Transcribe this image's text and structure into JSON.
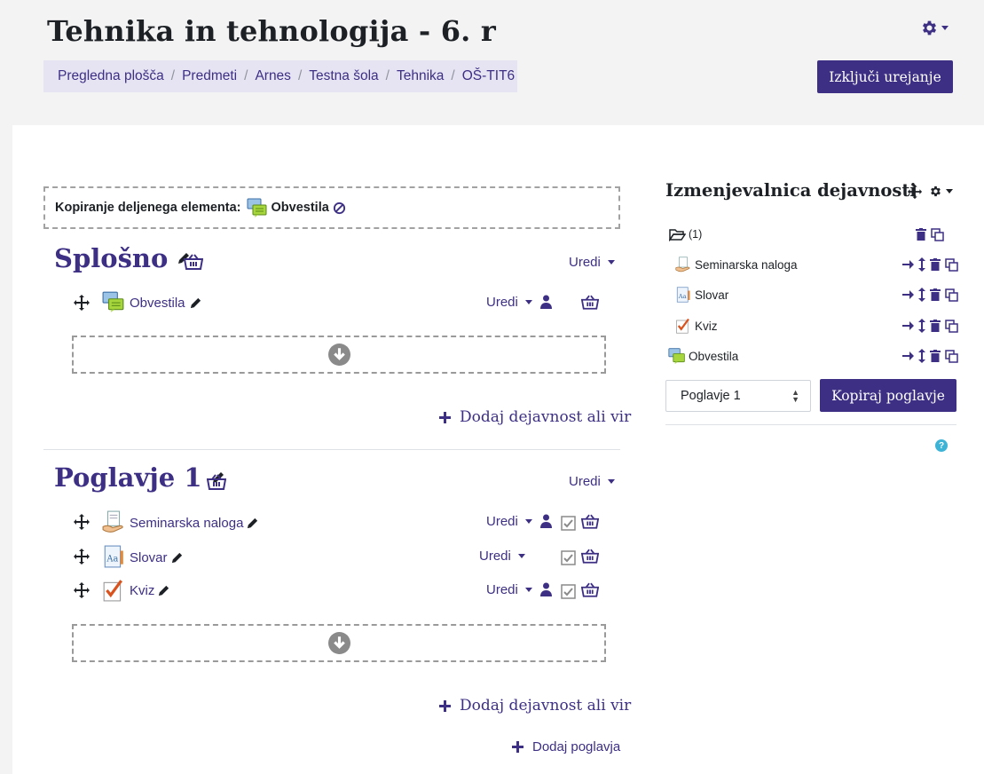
{
  "page": {
    "title": "Tehnika in tehnologija - 6. r",
    "edit_toggle_label": "Izključi urejanje"
  },
  "breadcrumb": [
    "Pregledna plošča",
    "Predmeti",
    "Arnes",
    "Testna šola",
    "Tehnika",
    "OŠ-TIT6"
  ],
  "copy_notice": {
    "label": "Kopiranje deljenega elementa:",
    "item": "Obvestila"
  },
  "sections": [
    {
      "title": "Splošno",
      "edit_label": "Uredi",
      "activities": [
        {
          "name": "Obvestila",
          "icon": "forum-icon",
          "edit_label": "Uredi"
        }
      ],
      "add_label": "Dodaj dejavnost ali vir"
    },
    {
      "title": "Poglavje 1",
      "edit_label": "Uredi",
      "activities": [
        {
          "name": "Seminarska naloga",
          "icon": "assignment-icon",
          "edit_label": "Uredi"
        },
        {
          "name": "Slovar",
          "icon": "glossary-icon",
          "edit_label": "Uredi"
        },
        {
          "name": "Kviz",
          "icon": "quiz-icon",
          "edit_label": "Uredi"
        }
      ],
      "add_label": "Dodaj dejavnost ali vir"
    }
  ],
  "add_section_label": "Dodaj poglavja",
  "sharing_cart": {
    "title": "Izmenjevalnica dejavnosti",
    "folder_label": "(1)",
    "items": [
      {
        "name": "Seminarska naloga",
        "icon": "assignment-icon"
      },
      {
        "name": "Slovar",
        "icon": "glossary-icon"
      },
      {
        "name": "Kviz",
        "icon": "quiz-icon"
      },
      {
        "name": "Obvestila",
        "icon": "forum-icon"
      }
    ],
    "section_select_value": "Poglavje 1",
    "copy_section_label": "Kopiraj poglavje",
    "help_label": "?"
  },
  "colors": {
    "brand": "#3d2f84",
    "breadcrumb_bg": "#e6e4f3",
    "help": "#3db3d6"
  }
}
